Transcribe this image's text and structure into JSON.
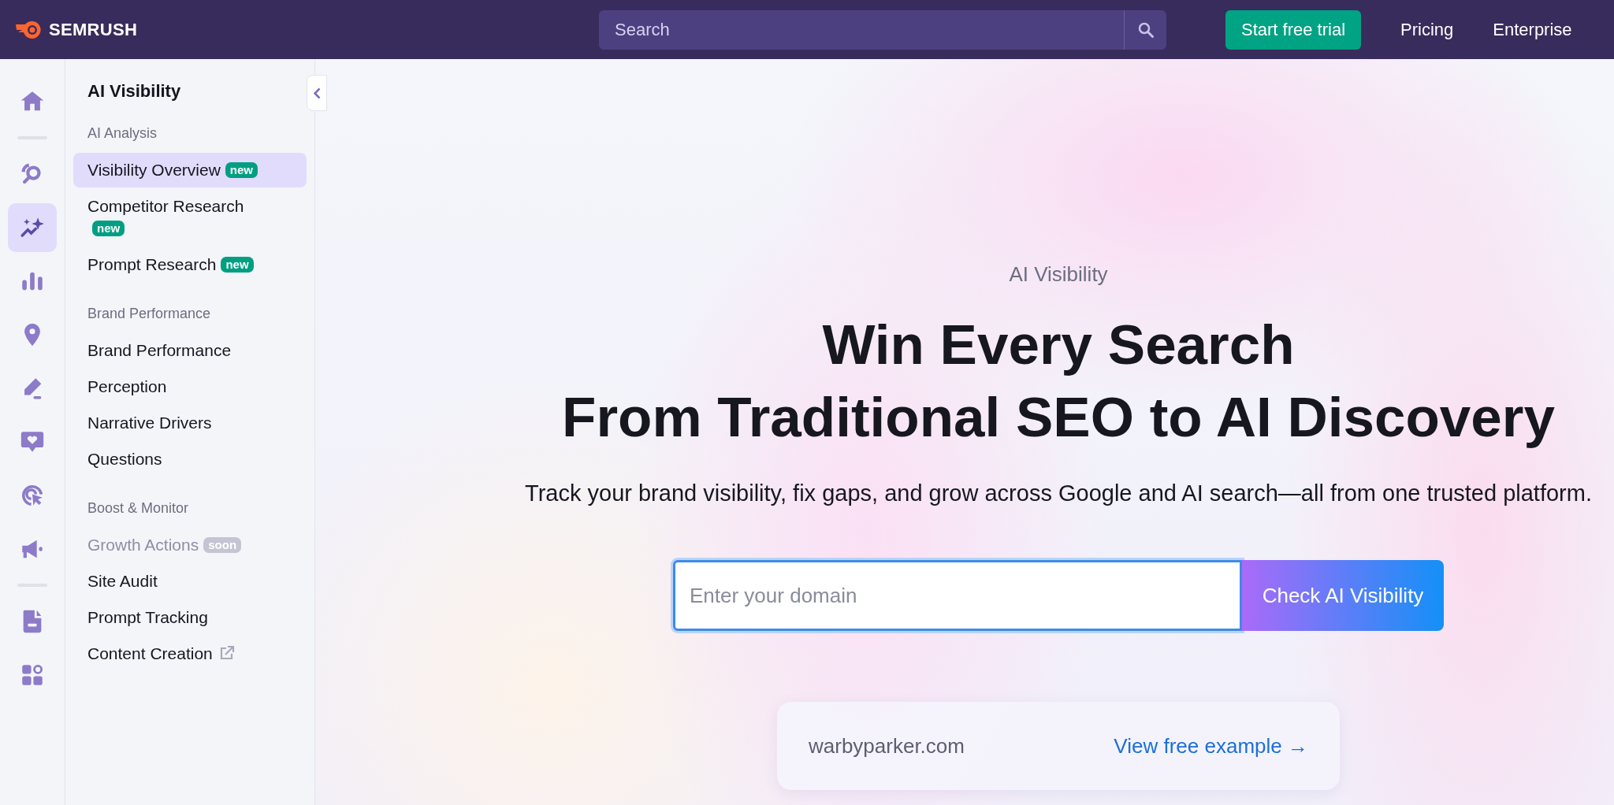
{
  "topbar": {
    "logo": "SEMRUSH",
    "search": {
      "placeholder": "Search"
    },
    "trial_button": "Start free trial",
    "links": [
      "Pricing",
      "Enterprise"
    ]
  },
  "rail": {
    "groups": [
      [
        {
          "selected": false
        }
      ],
      [
        {
          "selected": false
        },
        {
          "selected": true
        },
        {
          "selected": false
        },
        {
          "selected": false
        },
        {
          "selected": false
        },
        {
          "selected": false
        },
        {
          "selected": false
        },
        {
          "selected": false
        }
      ],
      [
        {
          "selected": false
        },
        {
          "selected": false
        }
      ]
    ]
  },
  "sidebar": {
    "title": "AI Visibility",
    "sections": [
      {
        "heading": "AI Analysis",
        "items": [
          {
            "label": "Visibility Overview",
            "selected": true,
            "disabled": false,
            "badge": {
              "text": "new",
              "kind": "new"
            }
          },
          {
            "label": "Competitor Research",
            "selected": false,
            "disabled": false,
            "badge": {
              "text": "new",
              "kind": "new"
            }
          },
          {
            "label": "Prompt Research",
            "selected": false,
            "disabled": false,
            "badge": {
              "text": "new",
              "kind": "new"
            }
          }
        ]
      },
      {
        "heading": "Brand Performance",
        "items": [
          {
            "label": "Brand Performance",
            "selected": false,
            "disabled": false
          },
          {
            "label": "Perception",
            "selected": false,
            "disabled": false
          },
          {
            "label": "Narrative Drivers",
            "selected": false,
            "disabled": false
          },
          {
            "label": "Questions",
            "selected": false,
            "disabled": false
          }
        ]
      },
      {
        "heading": "Boost & Monitor",
        "items": [
          {
            "label": "Growth Actions",
            "selected": false,
            "disabled": true,
            "badge": {
              "text": "soon",
              "kind": "soon"
            }
          },
          {
            "label": "Site Audit",
            "selected": false,
            "disabled": false
          },
          {
            "label": "Prompt Tracking",
            "selected": false,
            "disabled": false
          },
          {
            "label": "Content Creation",
            "selected": false,
            "disabled": false,
            "external": true
          }
        ]
      }
    ]
  },
  "hero": {
    "eyebrow": "AI Visibility",
    "headline": [
      "Win Every Search",
      "From Traditional SEO to AI Discovery"
    ],
    "subtitle": "Track your brand visibility, fix gaps, and grow across Google and AI search—all from one trusted platform.",
    "domain_field": {
      "placeholder": "Enter your domain"
    },
    "check_button": "Check AI Visibility",
    "example": {
      "domain": "warbyparker.com",
      "link": "View free example →"
    }
  }
}
